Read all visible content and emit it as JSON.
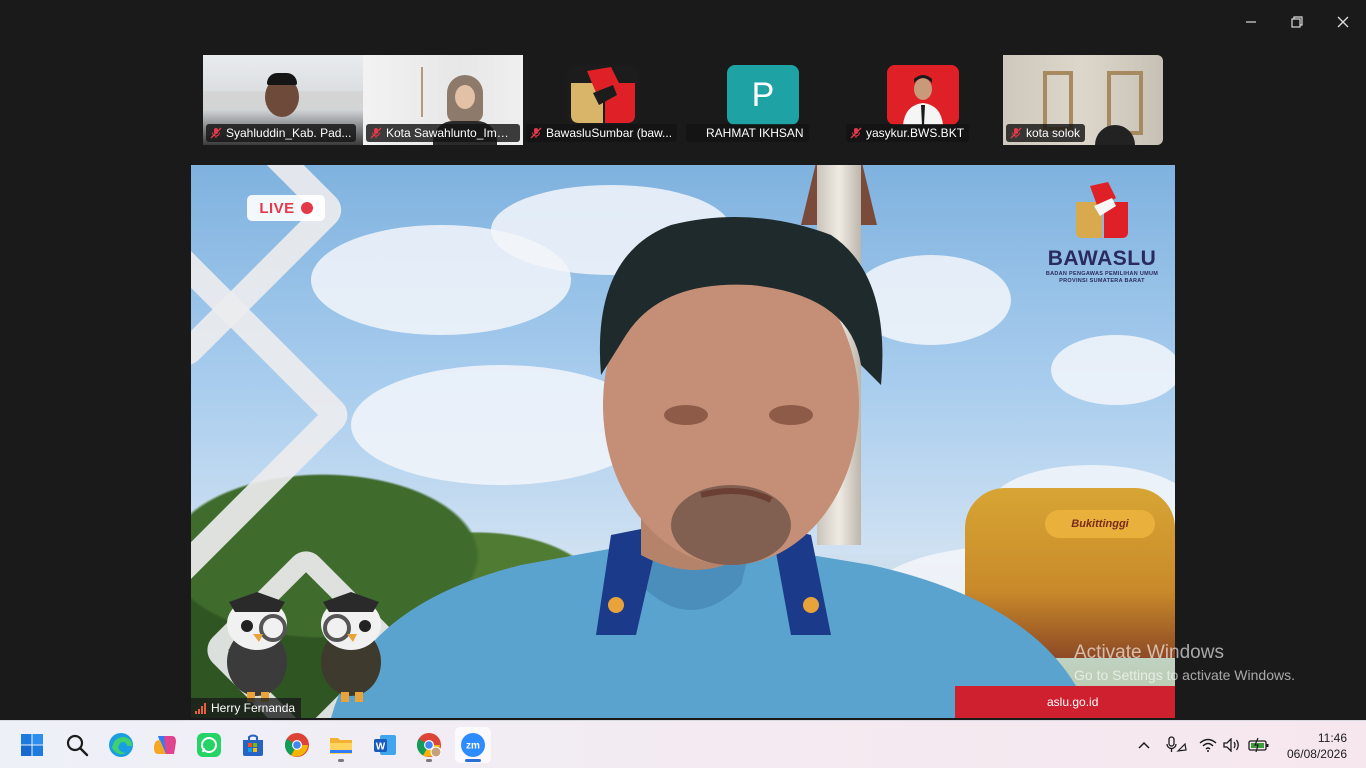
{
  "window": {
    "controls": [
      "minimize",
      "restore",
      "close"
    ]
  },
  "participants": [
    {
      "name": "Syahluddin_Kab. Pad...",
      "type": "video",
      "muted": true
    },
    {
      "name": "Kota Sawahlunto_Imel...",
      "type": "video",
      "muted": true
    },
    {
      "name": "BawasluSumbar (baw...",
      "type": "avatar-logo",
      "muted": true
    },
    {
      "name": "RAHMAT IKHSAN",
      "type": "avatar-letter",
      "avatar_letter": "P",
      "avatar_color": "#1fa2a4",
      "muted": false
    },
    {
      "name": "yasykur.BWS.BKT",
      "type": "avatar-photo",
      "avatar_color": "#e02027",
      "muted": true
    },
    {
      "name": "kota solok",
      "type": "video",
      "muted": true
    }
  ],
  "main_video": {
    "speaker_name": "Herry Fernanda",
    "live_label": "LIVE",
    "org_name": "BAWASLU",
    "org_subtitle_1": "BADAN PENGAWAS PEMILIHAN UMUM",
    "org_subtitle_2": "PROVINSI SUMATERA BARAT",
    "website": "aslu.go.id",
    "building_sign": "Bukittinggi"
  },
  "watermark": {
    "title": "Activate Windows",
    "subtitle": "Go to Settings to activate Windows."
  },
  "taskbar": {
    "apps": [
      "start",
      "search",
      "edge",
      "copilot",
      "whatsapp",
      "store",
      "chrome",
      "file-explorer",
      "word",
      "chrome-profile",
      "zoom"
    ],
    "active_app": "zoom",
    "time": "11:46",
    "date": "06/08/2026"
  },
  "colors": {
    "zoom_blue": "#2d8cff",
    "muted_red": "#e5394a",
    "bawaslu_red": "#cf2030"
  }
}
